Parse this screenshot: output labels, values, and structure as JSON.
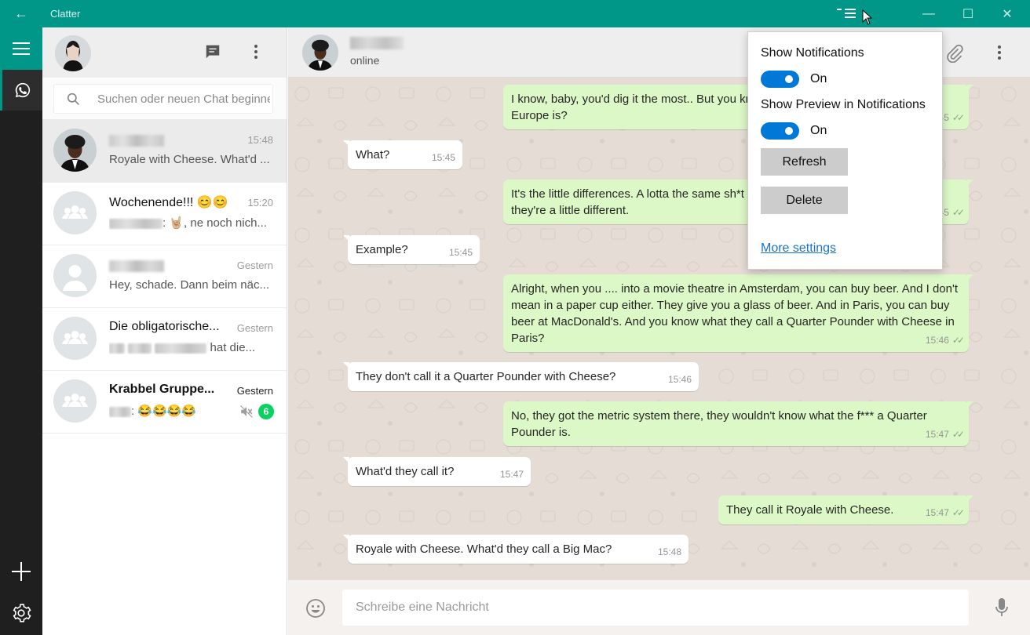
{
  "window": {
    "title": "Clatter",
    "back_glyph": "←",
    "controls": {
      "minimize": "—",
      "maximize": "☐",
      "close": "✕"
    }
  },
  "rail": {
    "icons": [
      "hamburger-icon",
      "whatsapp-icon",
      "plus-icon",
      "settings-gear-icon"
    ]
  },
  "chat_list": {
    "header_icons": [
      "new-chat-icon",
      "more-vert-icon"
    ],
    "search": {
      "placeholder": "Suchen oder neuen Chat beginnen"
    },
    "chats": [
      {
        "name": "",
        "time": "15:48",
        "preview": "Royale with Cheese. What'd ...",
        "avatar": "contact-photo",
        "active": true
      },
      {
        "name": "Wochenende!!! 😊😊",
        "time": "15:20",
        "preview_suffix": ": 🤘🏼, ne noch nich...",
        "avatar": "group-icon"
      },
      {
        "name": "",
        "time": "Gestern",
        "preview": "Hey, schade. Dann beim näc...",
        "avatar": "person-icon"
      },
      {
        "name": "Die obligatorische...",
        "time": "Gestern",
        "preview_suffix": "hat die...",
        "avatar": "group-icon"
      },
      {
        "name": "Krabbel Gruppe...",
        "time": "Gestern",
        "preview_suffix": ": 😂😂😂😂",
        "avatar": "group-icon",
        "muted": true,
        "unread": "6"
      }
    ]
  },
  "conversation": {
    "contact_status": "online",
    "messages": [
      {
        "dir": "out",
        "text": "I know, baby, you'd dig it the most.. But you know what the funniest thing about Europe is?",
        "time": "15:45"
      },
      {
        "dir": "in",
        "text": "What?",
        "time": "15:45"
      },
      {
        "dir": "out",
        "text": "It's the little differences. A lotta the same sh*t we got here, they got there, but there they're a little different.",
        "time": "15:45"
      },
      {
        "dir": "in",
        "text": "Example?",
        "time": "15:45"
      },
      {
        "dir": "out",
        "text": "Alright, when you .... into a movie theatre in Amsterdam, you can buy beer. And I don't mean in a paper cup either. They give you a glass of beer. And in Paris, you can buy beer at MacDonald's. And you know what they call a Quarter Pounder with Cheese in Paris?",
        "time": "15:46"
      },
      {
        "dir": "in",
        "text": "They don't call it a Quarter Pounder with Cheese?",
        "time": "15:46"
      },
      {
        "dir": "out",
        "text": "No, they got the metric system there, they wouldn't know what the f*** a Quarter Pounder is.",
        "time": "15:47"
      },
      {
        "dir": "in",
        "text": "What'd they call it?",
        "time": "15:47"
      },
      {
        "dir": "out",
        "text": "They call it Royale with Cheese.",
        "time": "15:47"
      },
      {
        "dir": "in",
        "text": "Royale with Cheese. What'd they call a Big Mac?",
        "time": "15:48"
      }
    ],
    "compose": {
      "placeholder": "Schreibe eine Nachricht"
    }
  },
  "notification_menu": {
    "show_notifications_label": "Show Notifications",
    "show_notifications_state": "On",
    "show_preview_label": "Show Preview in Notifications",
    "show_preview_state": "On",
    "refresh_label": "Refresh",
    "delete_label": "Delete",
    "more_settings_label": "More settings"
  },
  "colors": {
    "accent": "#009688",
    "outgoing_bubble": "#dcf8c6",
    "toggle_on": "#0078d7",
    "unread_badge": "#09d261"
  }
}
